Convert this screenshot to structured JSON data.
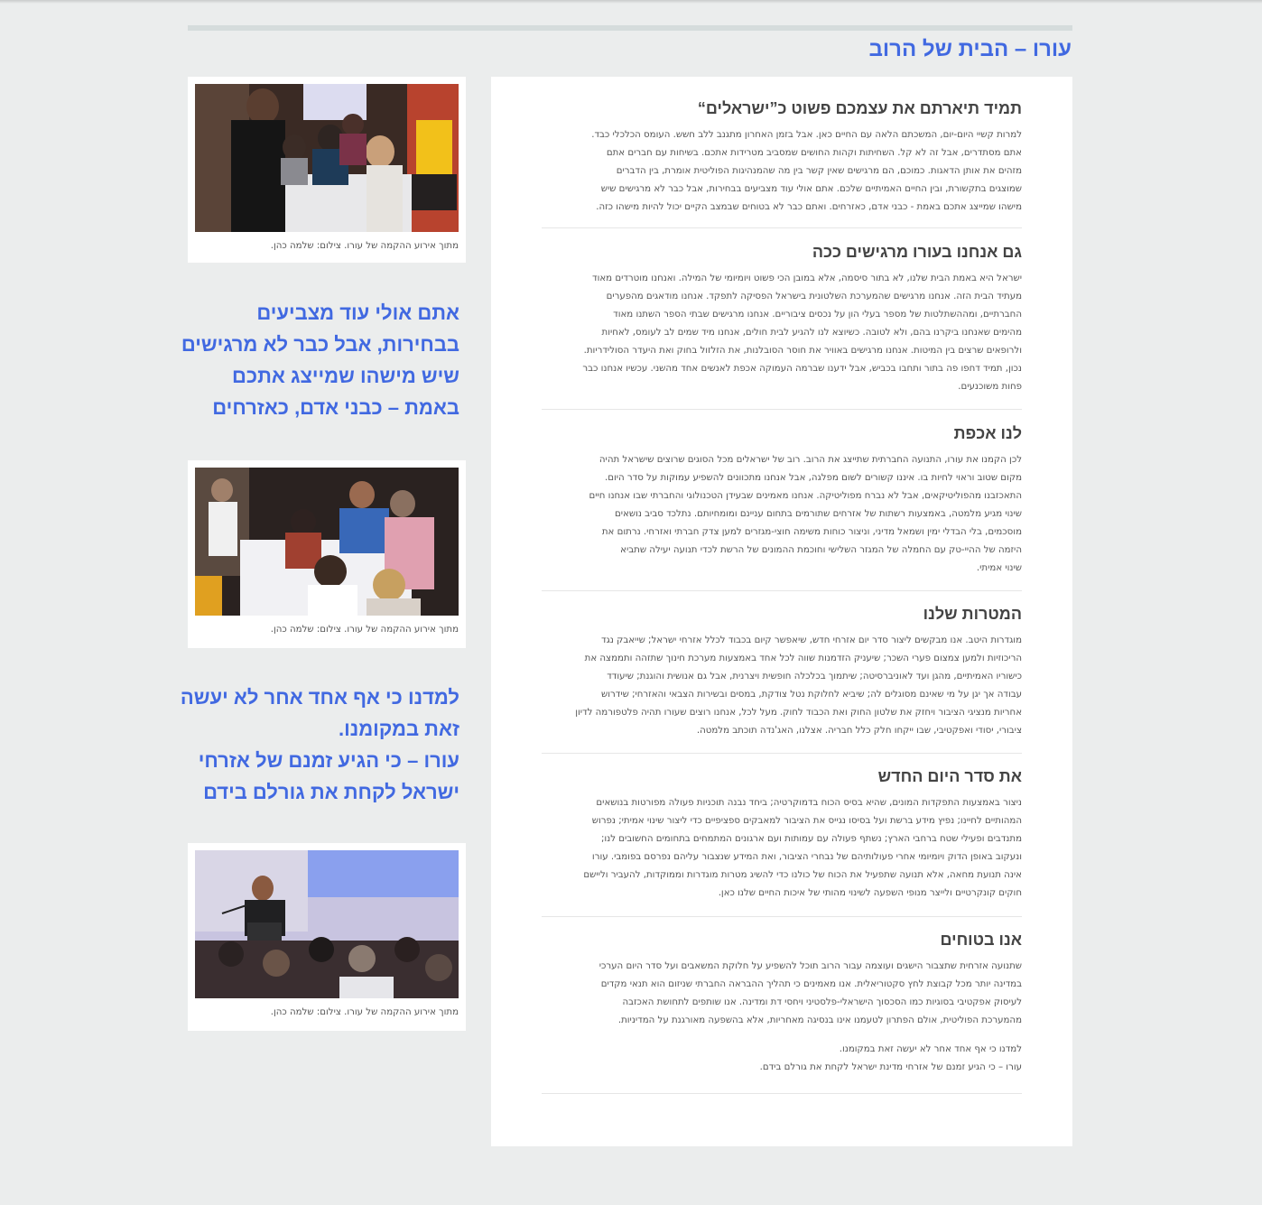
{
  "page_title": "עורו – הבית של הרוב",
  "sections": [
    {
      "title": "תמיד תיארתם את עצמכם פשוט כ”ישראלים“",
      "lines": [
        "למרות קשיי היום-יום, המשכתם הלאה עם החיים כאן. אבל בזמן האחרון מתגנב ללב חשש. העומס הכלכלי כבד.",
        "אתם מסתדרים, אבל זה לא קל. השחיתות וקהות החושים שמסביב מטרידות אתכם. בשיחות עם חברים אתם",
        "מזהים את אותן הדאגות. כמוכם, הם מרגישים שאין קשר בין מה שהמנהיגות הפוליטית אומרת, בין הדברים",
        "שמוצגים בתקשורת, ובין החיים האמיתיים שלכם. אתם אולי עוד מצביעים בבחירות, אבל כבר לא מרגישים שיש",
        "מישהו שמייצג אתכם באמת - כבני אדם, כאזרחים. ואתם כבר לא בטוחים שבמצב הקיים יכול להיות מישהו כזה."
      ]
    },
    {
      "title": "גם אנחנו בעורו מרגישים ככה",
      "lines": [
        "ישראל היא באמת הבית שלנו, לא בתור סיסמה, אלא במובן הכי פשוט ויומיומי של המילה. ואנחנו מוטרדים מאוד",
        "מעתיד הבית הזה. אנחנו מרגישים שהמערכת השלטונית בישראל הפסיקה לתפקד. אנחנו מודאגים מהפערים",
        "החברתיים, ומההשתלטות של מספר בעלי הון על נכסים ציבוריים. אנחנו מרגישים שבתי הספר השתנו מאוד",
        "מהימים שאנחנו ביקרנו בהם, ולא לטובה. כשיוצא לנו להגיע לבית חולים, אנחנו מיד שמים לב לעומס, לאחיות",
        "ולרופאים שרצים בין המיטות. אנחנו מרגישים באוויר את חוסר הסובלנות, את הזלזול בחוק ואת היעדר הסולידריות.",
        "נכון, תמיד דחפו פה בתור ותחבו בכביש, אבל ידענו שברמה העמוקה אכפת לאנשים אחד מהשני. עכשיו אנחנו כבר",
        "פחות משוכנעים."
      ]
    },
    {
      "title": "לנו אכפת",
      "lines": [
        "לכן הקמנו את עורו, התנועה החברתית שתייצג את הרוב. רוב של ישראלים מכל הסוגים שרוצים שישראל תהיה",
        "מקום שטוב וראוי לחיות בו. איננו קשורים לשום מפלגה, אבל אנחנו מתכוונים להשפיע עמוקות על סדר היום.",
        "התאכזבנו מהפוליטיקאים, אבל לא נברח מפוליטיקה. אנחנו מאמינים שבעידן הטכנולוגי והחברתי שבו אנחנו חיים",
        "שינוי מגיע מלמטה, באמצעות רשתות של אזרחים שתורמים בתחום עניינם ומומחיותם. נתלכד סביב נושאים",
        "מוסכמים, בלי הבדלי ימין ושמאל מדיני, וניצור כוחות משימה חוצי-מגזרים למען צדק חברתי ואזרחי. נרתום את",
        "היזמה של ההיי-טק עם החמלה של המגזר השלישי וחוכמת ההמונים של הרשת לכדי תנועה יעילה שתביא",
        "שינוי אמיתי."
      ]
    },
    {
      "title": "המטרות שלנו",
      "lines": [
        "מוגדרות היטב. אנו מבקשים ליצור סדר יום אזרחי חדש, שיאפשר קיום בכבוד לכלל אזרחי ישראל; שייאבק נגד",
        "הריכוזיות ולמען צמצום פערי השכר; שיעניק הזדמנות שווה לכל אחד באמצעות מערכת חינוך שתזהה ותממצה את",
        "כישוריו האמיתיים, מהגן ועד לאוניברסיטה; שיתמוך בכלכלה חופשית ויצרנית, אבל גם אנושית והוגנת; שיעודד",
        "עבודה אך יגן על מי שאינם מסוגלים לה; שיביא לחלוקת נטל צודקת, במסים ובשירות הצבאי והאזרחי; שידרוש",
        "אחריות מנציגי הציבור ויחזק את שלטון החוק ואת הכבוד לחוק. מעל לכל, אנחנו רוצים שעורו תהיה פלטפורמה לדיון",
        "ציבורי, יסודי ואפקטיבי, שבו ייקחו חלק כלל חבריה. אצלנו, האג'נדה תוכתב מלמטה."
      ]
    },
    {
      "title": "את סדר היום החדש",
      "lines": [
        "ניצור באמצעות התפקדות המונים, שהיא בסיס הכוח בדמוקרטיה; ביחד נבנה תוכניות פעולה מפורטות בנושאים",
        "המהותיים לחיינו; נפיץ מידע ברשת ועל בסיסו נגייס את הציבור למאבקים ספציפיים כדי ליצור שינוי אמיתי; נפרוש",
        "מתנדבים ופעילי שטח ברחבי הארץ; נשתף פעולה עם עמותות ועם ארגונים המתמחים בתחומים החשובים לנו;",
        "ונעקוב באופן הדוק ויומיומי אחרי פעולותיהם של נבחרי הציבור, ואת המידע שנצבור עליהם נפרסם בפומבי. עורו",
        "אינה תנועת מחאה, אלא תנועה שתפעיל את הכוח של כולנו כדי להשיג מטרות מוגדרות וממוקדות, להעביר וליישם",
        "חוקים קונקרטיים ולייצר מנופי השפעה לשינוי מהותי של איכות החיים שלנו כאן."
      ]
    },
    {
      "title": "אנו בטוחים",
      "lines": [
        "שתנועה אזרחית שתצבור הישגים ועוצמה עבור הרוב תוכל להשפיע על חלוקת המשאבים ועל סדר היום הערכי",
        "במדינה יותר מכל קבוצת לחץ סקטוריאלית. אנו מאמינים כי תהליך ההבראה החברתי שניזום הוא תנאי מקדים",
        "לעיסוק אפקטיבי בסוגיות כמו הסכסוך הישראלי-פלסטיני ויחסי דת ומדינה. אנו שותפים לתחושת האכזבה",
        "מהמערכת הפוליטית, אולם הפתרון לטעמנו אינו בנסיגה מאחריות, אלא בהשפעה מאורגנת על המדיניות."
      ],
      "closing": [
        "למדנו כי אף אחד אחר לא יעשה זאת במקומנו.",
        "עורו – כי הגיע זמנם של אזרחי מדינת ישראל לקחת את גורלם בידם."
      ]
    }
  ],
  "sidebar": {
    "photos": [
      {
        "caption": "מתוך אירוע ההקמה של עורו. צילום: שלמה כהן.",
        "alt": "event-photo-crowd-writing"
      },
      {
        "caption": "מתוך אירוע ההקמה של עורו. צילום: שלמה כהן.",
        "alt": "event-photo-table-signing"
      },
      {
        "caption": "מתוך אירוע ההקמה של עורו. צילום: שלמה כהן.",
        "alt": "event-photo-speaker"
      }
    ],
    "quote1": [
      "אתם אולי עוד מצביעים",
      "בבחירות, אבל כבר לא מרגישים",
      "שיש מישהו שמייצג אתכם",
      "באמת – כבני אדם, כאזרחים"
    ],
    "quote2": [
      "למדנו כי אף אחד אחר לא יעשה",
      "זאת במקומנו.",
      "עורו – כי הגיע זמנם של אזרחי",
      "ישראל לקחת את גורלם בידם"
    ]
  },
  "colors": {
    "accent": "#4169e1",
    "background": "#ebeded",
    "heading": "#444444",
    "body_text": "#555555"
  }
}
